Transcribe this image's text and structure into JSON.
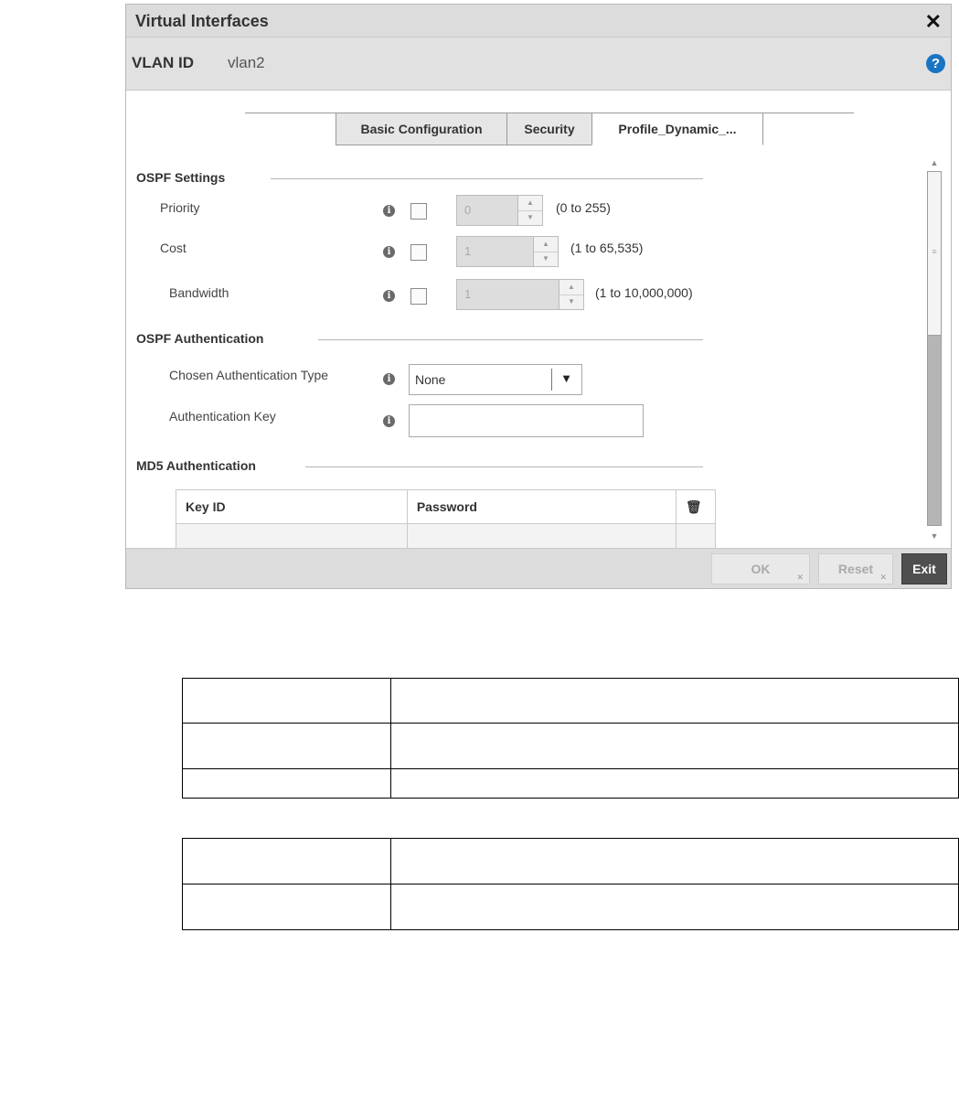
{
  "dialog": {
    "title": "Virtual Interfaces",
    "close_glyph": "✕",
    "vlan_label": "VLAN ID",
    "vlan_value": "vlan2",
    "help_glyph": "?"
  },
  "tabs": [
    {
      "label": "Basic Configuration"
    },
    {
      "label": "Security"
    },
    {
      "label": "Profile_Dynamic_..."
    }
  ],
  "ospf_settings": {
    "title": "OSPF Settings",
    "fields": [
      {
        "label": "Priority",
        "value": "0",
        "range": "(0 to 255)"
      },
      {
        "label": "Cost",
        "value": "1",
        "range": "(1 to 65,535)"
      },
      {
        "label": "Bandwidth",
        "value": "1",
        "range": "(1 to 10,000,000)"
      }
    ]
  },
  "ospf_auth": {
    "title": "OSPF Authentication",
    "type_label": "Chosen Authentication Type",
    "type_value": "None",
    "key_label": "Authentication Key",
    "key_value": ""
  },
  "md5_auth": {
    "title": "MD5 Authentication",
    "columns": [
      "Key ID",
      "Password"
    ]
  },
  "footer": {
    "ok_label": "OK",
    "reset_label": "Reset",
    "exit_label": "Exit"
  },
  "icons": {
    "info": "i",
    "trash": "🗑",
    "select_arrow": "▼",
    "spin_up": "▲",
    "spin_down": "▼"
  }
}
